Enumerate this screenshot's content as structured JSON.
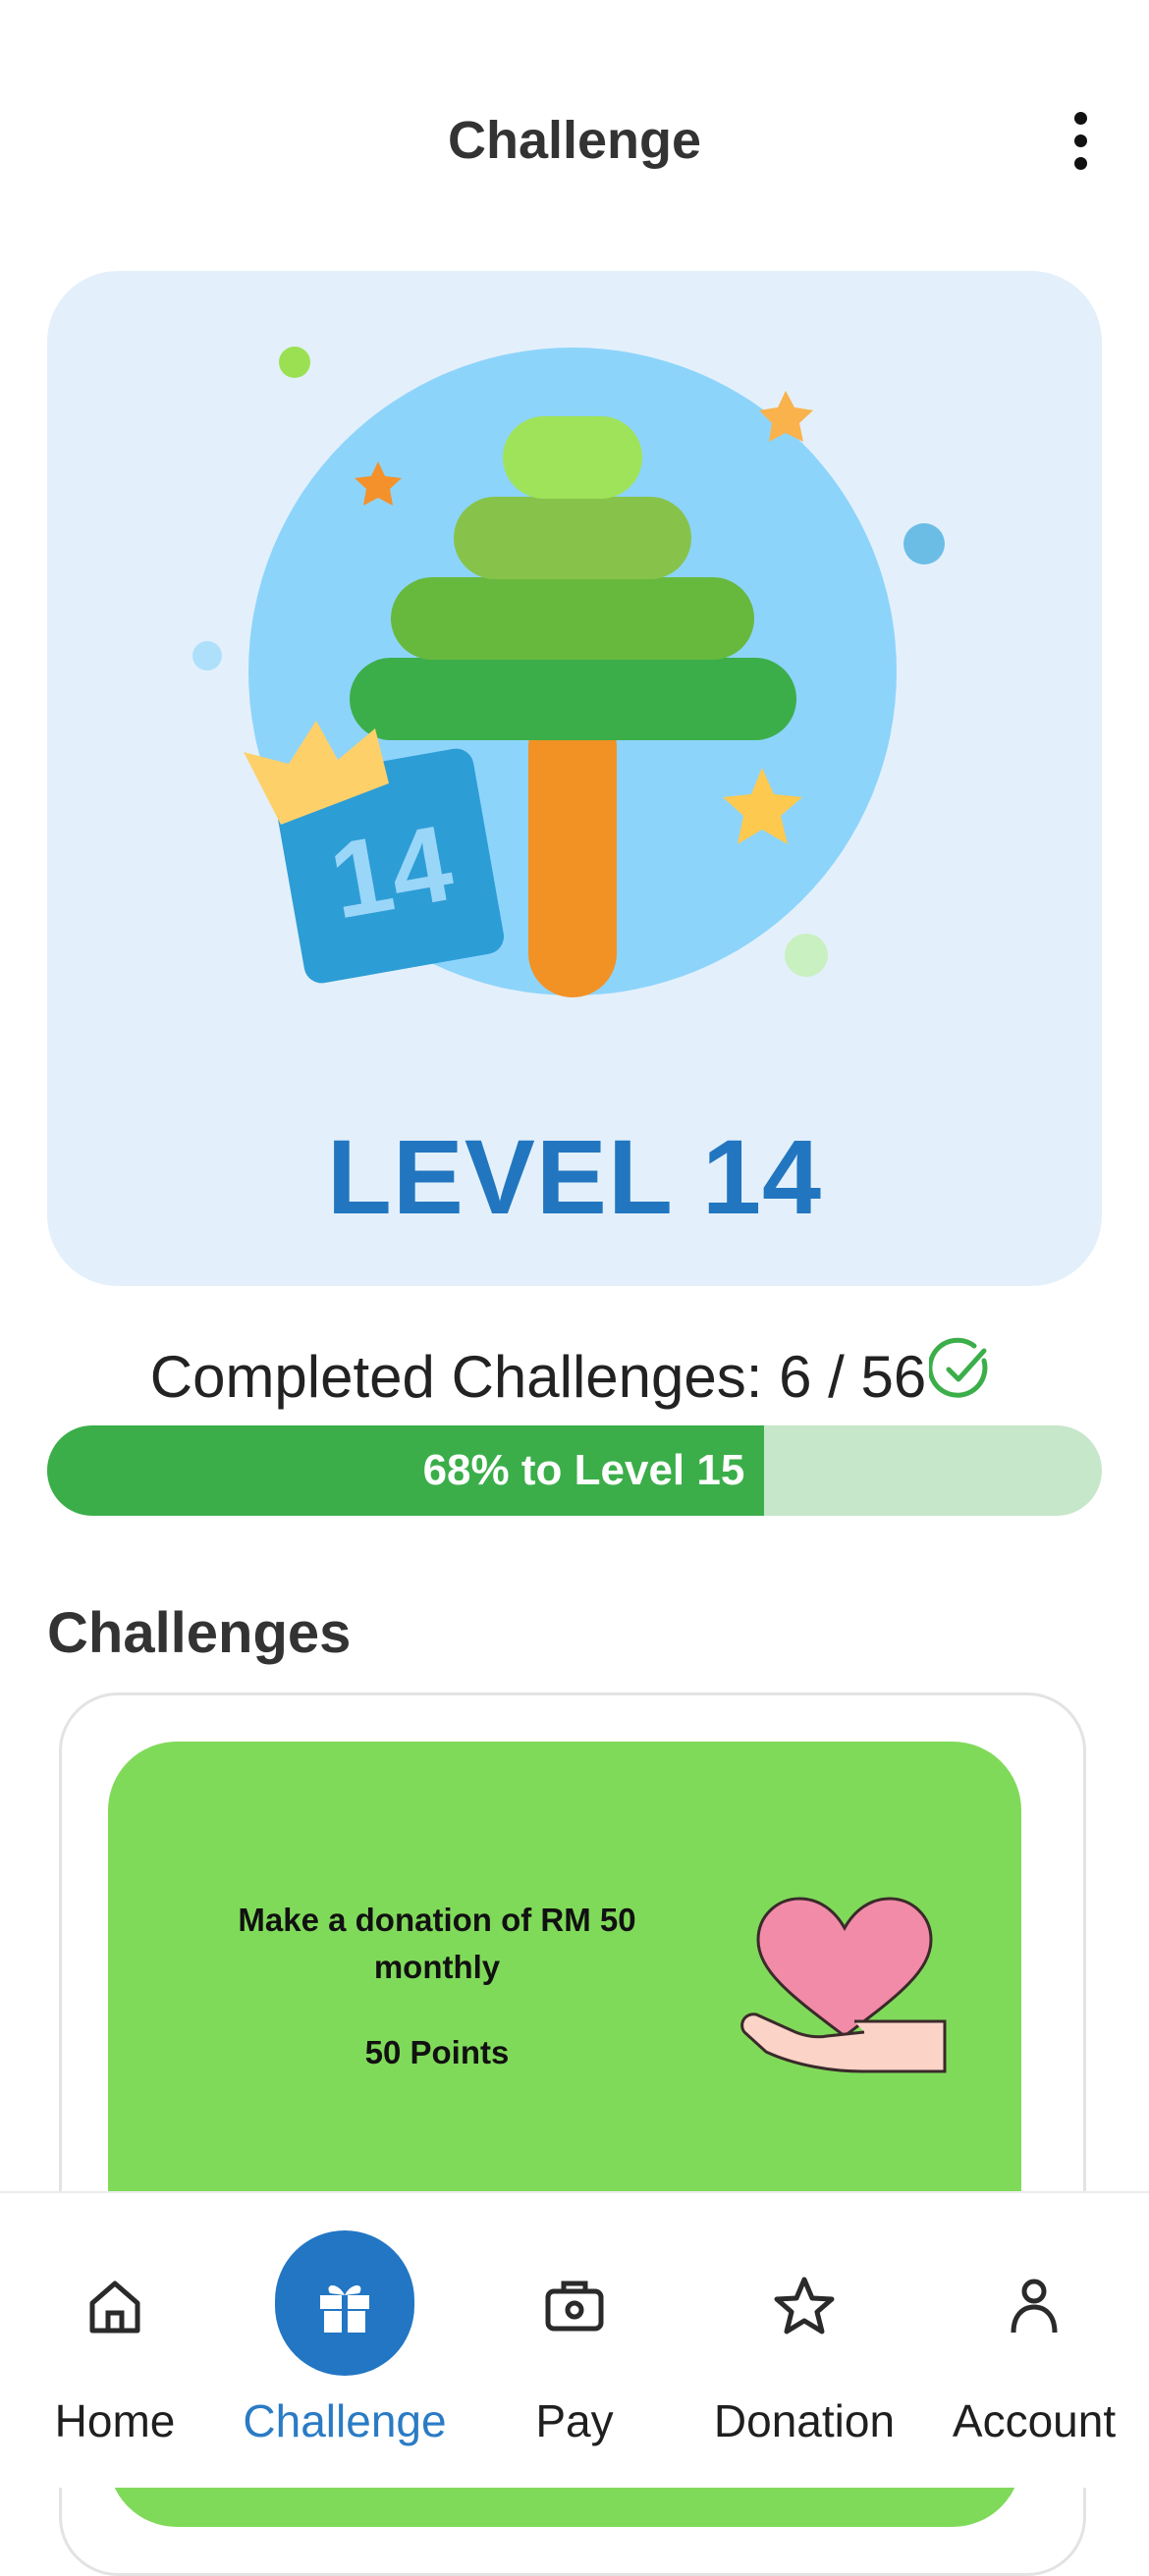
{
  "header": {
    "title": "Challenge",
    "menu_icon": "more-vertical-icon"
  },
  "level": {
    "label": "LEVEL 14",
    "badge_number": "14"
  },
  "progress": {
    "title": "Completed Challenges: 6 / 56",
    "bar_text": "68% to Level 15",
    "percent": 68,
    "fill_color": "#3bae4a",
    "track_color": "#c6e7c9",
    "check_icon": "check-circle-icon"
  },
  "challenges": {
    "section_title": "Challenges",
    "items": [
      {
        "text": "Make a donation of RM 50 monthly",
        "points": "50 Points",
        "icon": "heart-hand-icon",
        "color": "#80da5a"
      }
    ]
  },
  "nav": {
    "items": [
      {
        "label": "Home",
        "icon": "home-icon"
      },
      {
        "label": "Challenge",
        "icon": "gift-icon",
        "active": true
      },
      {
        "label": "Pay",
        "icon": "wallet-icon"
      },
      {
        "label": "Donation",
        "icon": "star-icon"
      },
      {
        "label": "Account",
        "icon": "person-icon"
      }
    ],
    "active_color": "#2276c4"
  }
}
